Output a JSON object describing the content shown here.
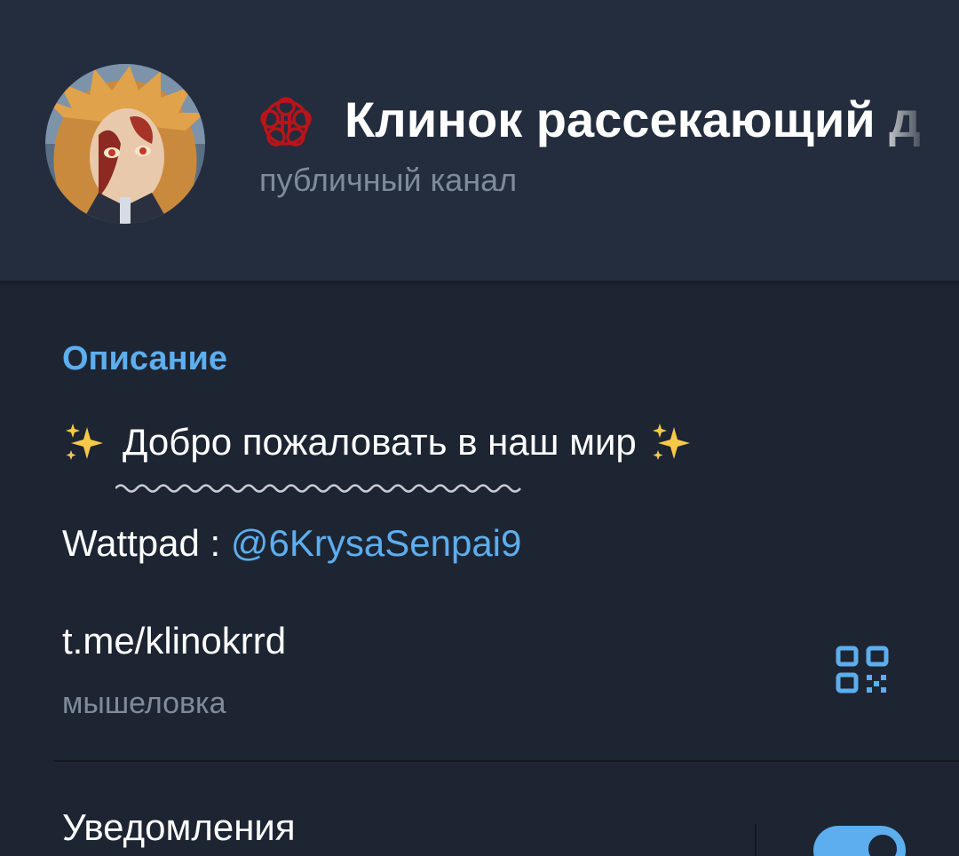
{
  "colors": {
    "header_bg": "#232d3d",
    "page_bg": "#1d2533",
    "accent": "#5daeee",
    "secondary_text": "#7f8b9b"
  },
  "header": {
    "avatar_icon": "channel-avatar-anime-art",
    "emblem_icon": "red-crest-icon",
    "title": "Клинок рассекающий д",
    "subtitle": "публичный канал"
  },
  "info": {
    "section_title": "Описание",
    "description": {
      "sparkle_icon": "sparkles-icon",
      "text": "Добро пожаловать в наш мир"
    },
    "wattpad": {
      "label": "Wattpad : ",
      "handle": "@6KrysaSenpai9"
    },
    "link": {
      "url": "t.me/klinokrrd",
      "caption": "мышеловка",
      "qr_icon": "qr-code-icon"
    },
    "notifications": {
      "label": "Уведомления",
      "enabled": true
    }
  }
}
